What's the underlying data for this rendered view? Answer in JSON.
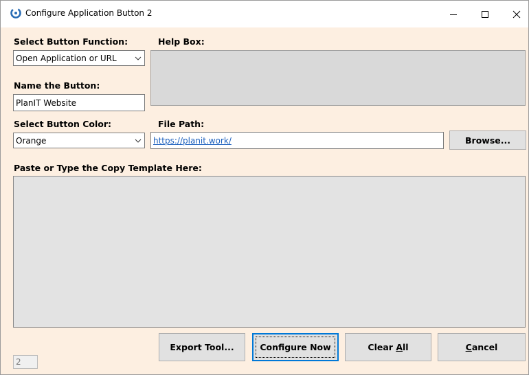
{
  "window": {
    "title": "Configure Application Button 2",
    "minimize_icon": "minimize-icon",
    "maximize_icon": "maximize-icon",
    "close_icon": "close-icon"
  },
  "function_select": {
    "label": "Select Button Function:",
    "value": "Open Application or URL"
  },
  "help": {
    "label": "Help Box:",
    "content": ""
  },
  "name": {
    "label": "Name the Button:",
    "value": "PlanIT Website"
  },
  "color_select": {
    "label": "Select Button Color:",
    "value": "Orange"
  },
  "file_path": {
    "label": "File Path:",
    "value": "https://planit.work/"
  },
  "browse_label": "Browse...",
  "template": {
    "label": "Paste or Type the Copy Template Here:",
    "content": ""
  },
  "buttons": {
    "export": "Export Tool...",
    "configure": "Configure Now",
    "clear_prefix": "Clear ",
    "clear_accel": "A",
    "clear_suffix": "ll",
    "cancel_accel": "C",
    "cancel_suffix": "ancel"
  },
  "counter_value": "2",
  "colors": {
    "form_background": "#fdefe1",
    "readonly_fill": "#d9d9d9",
    "link": "#1a5fbd",
    "focus_border": "#0078d7"
  }
}
